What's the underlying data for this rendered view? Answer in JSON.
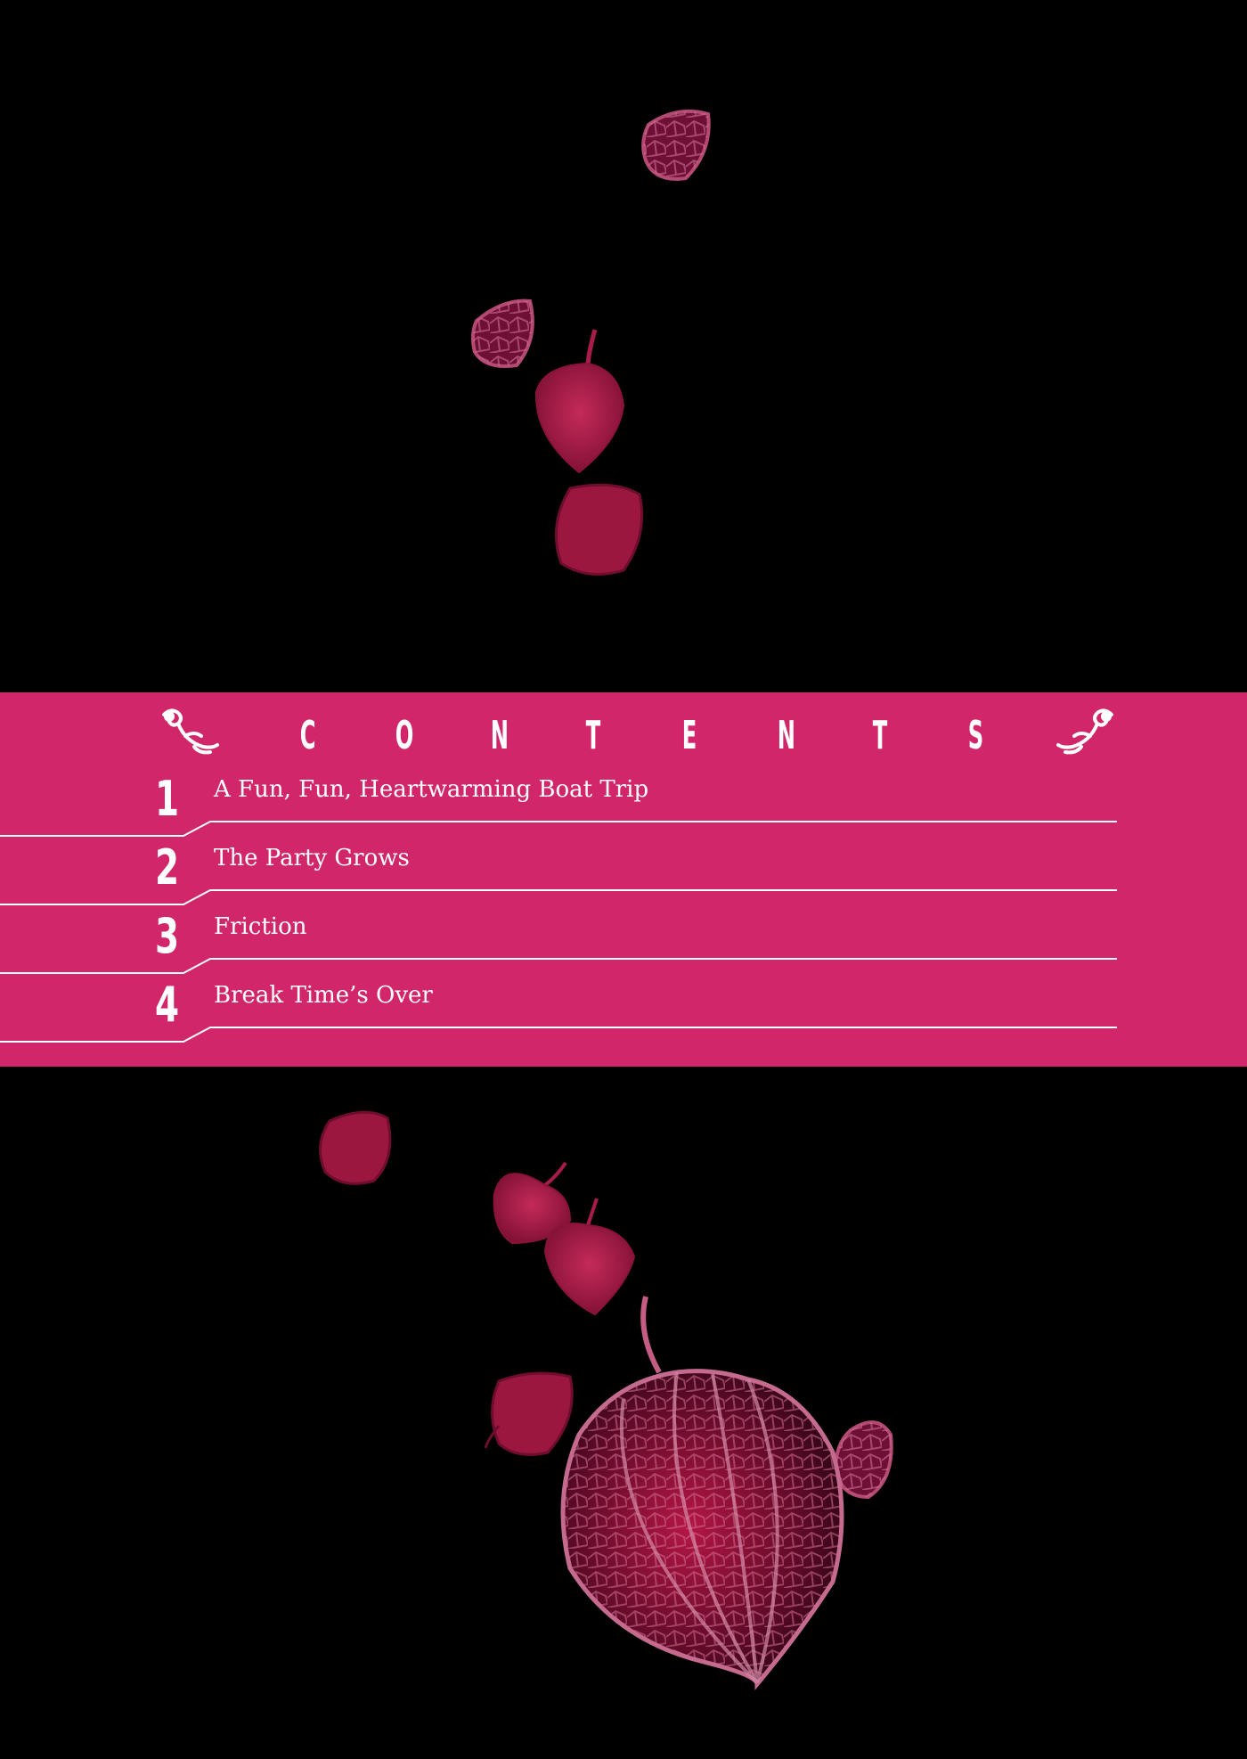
{
  "page": {
    "background_color": "#000000",
    "band_color": "#d1266a",
    "text_color": "#ffffff",
    "lantern_color": "#a81c4c"
  },
  "contents": {
    "heading_letters": [
      "C",
      "O",
      "N",
      "T",
      "E",
      "N",
      "T",
      "S"
    ],
    "ornament_left_icon": "flourish-ornament-icon",
    "ornament_right_icon": "flourish-ornament-icon",
    "entries": [
      {
        "number": "1",
        "title": "A Fun, Fun, Heartwarming Boat Trip"
      },
      {
        "number": "2",
        "title": "The Party Grows"
      },
      {
        "number": "3",
        "title": "Friction"
      },
      {
        "number": "4",
        "title": "Break Time’s Over"
      }
    ]
  },
  "illustration": {
    "subject_icon": "chinese-lantern-plant-icon"
  }
}
